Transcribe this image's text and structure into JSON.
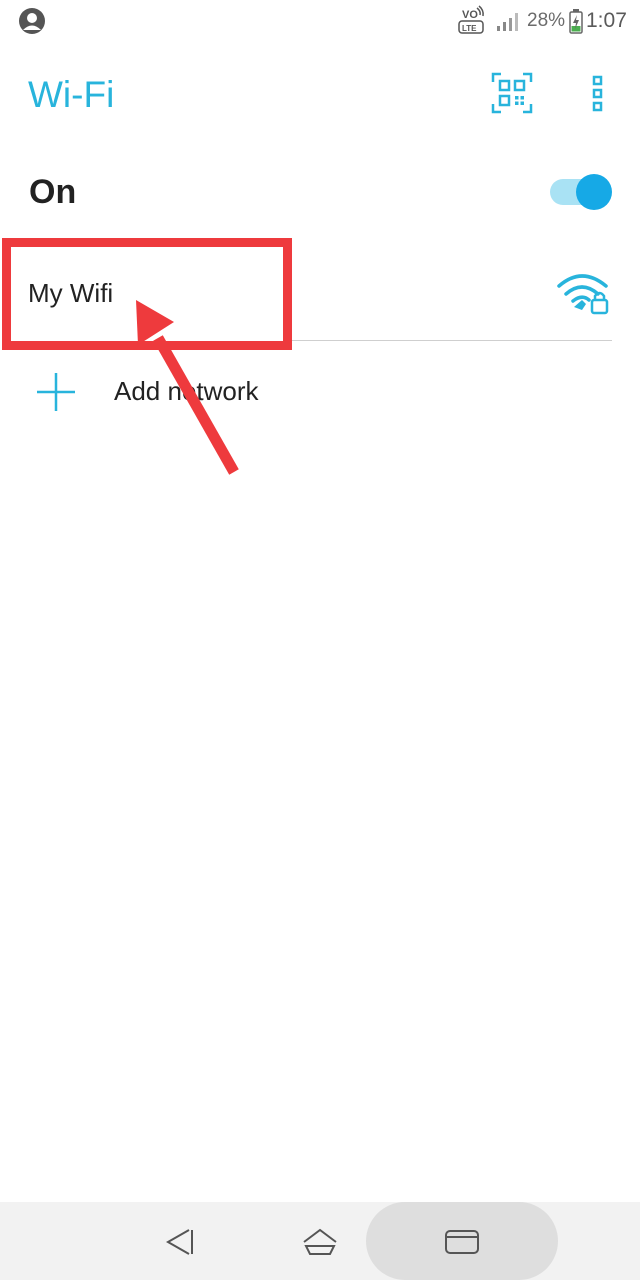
{
  "status_bar": {
    "battery_percent": "28%",
    "time": "1:07",
    "volte_top": "VO",
    "volte_bottom": "LTE",
    "icons": [
      "avatar-icon",
      "volte-icon",
      "signal-icon",
      "battery-charging-icon"
    ]
  },
  "app_bar": {
    "title": "Wi-Fi",
    "actions": [
      "qr-code-icon",
      "more-vert-icon"
    ]
  },
  "wifi_toggle": {
    "label": "On",
    "state": true
  },
  "networks": [
    {
      "name": "My Wifi",
      "icon": "wifi-lock-icon",
      "secured": true
    }
  ],
  "add_network": {
    "label": "Add network",
    "icon": "plus-icon"
  },
  "nav_bar": {
    "buttons": [
      "back-icon",
      "home-icon",
      "recent-apps-icon"
    ]
  },
  "colors": {
    "accent": "#28b4dc",
    "toggle_thumb": "#16a9e6",
    "toggle_track": "#a9e2f4",
    "annotation": "#ee3a3d"
  }
}
